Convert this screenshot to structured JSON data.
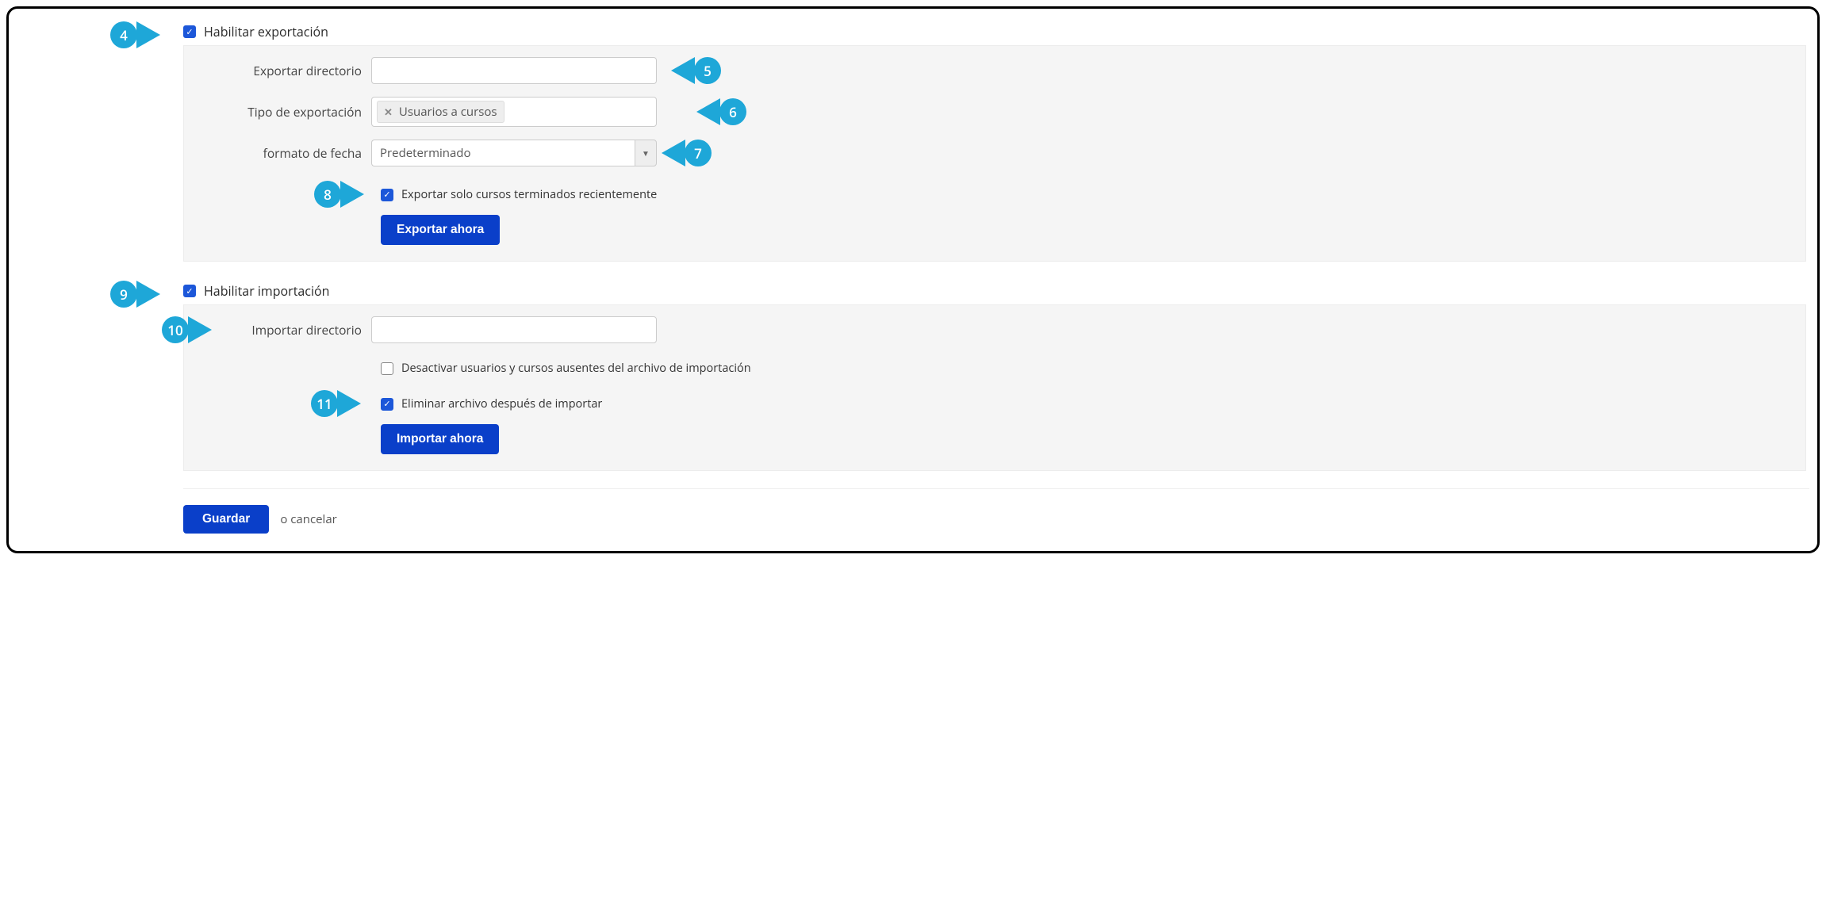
{
  "export_section": {
    "enable_label": "Habilitar exportación",
    "enable_checked": true,
    "dir_label": "Exportar directorio",
    "dir_value": "",
    "type_label": "Tipo de exportación",
    "type_tag": "Usuarios a cursos",
    "date_format_label": "formato de fecha",
    "date_format_value": "Predeterminado",
    "recent_only_label": "Exportar solo cursos terminados recientemente",
    "recent_only_checked": true,
    "export_now_button": "Exportar ahora"
  },
  "import_section": {
    "enable_label": "Habilitar importación",
    "enable_checked": true,
    "dir_label": "Importar directorio",
    "dir_value": "",
    "deactivate_label": "Desactivar usuarios y cursos ausentes del archivo de importación",
    "deactivate_checked": false,
    "delete_after_label": "Eliminar archivo después de importar",
    "delete_after_checked": true,
    "import_now_button": "Importar ahora"
  },
  "footer": {
    "save_button": "Guardar",
    "cancel_text": "o cancelar"
  },
  "markers": {
    "m4": "4",
    "m5": "5",
    "m6": "6",
    "m7": "7",
    "m8": "8",
    "m9": "9",
    "m10": "10",
    "m11": "11"
  }
}
